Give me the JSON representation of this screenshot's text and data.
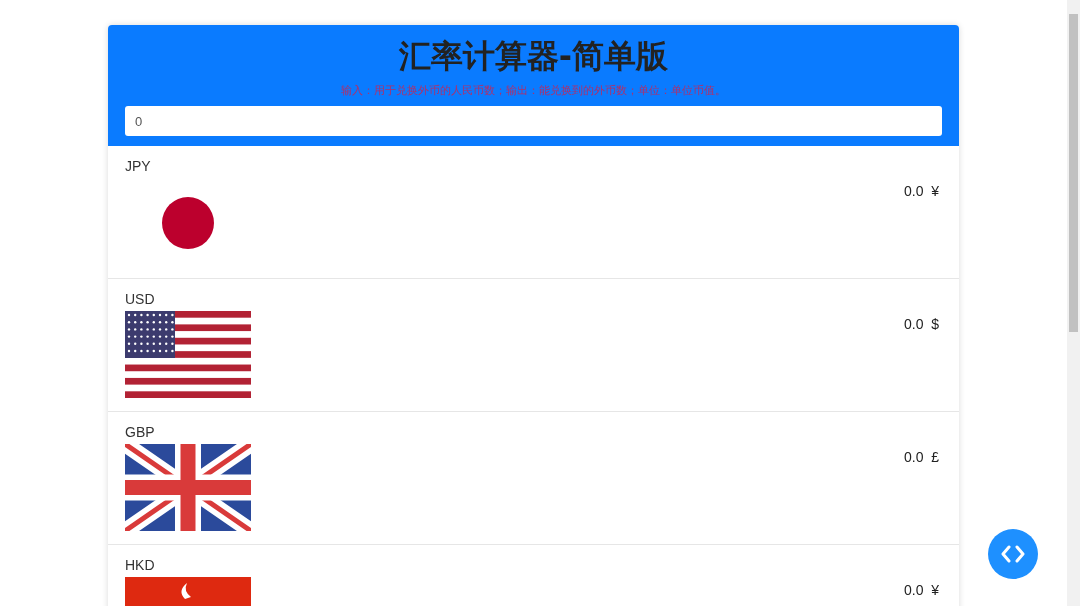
{
  "header": {
    "title": "汇率计算器-简单版",
    "subtitle": "输入：用于兑换外币的人民币数；输出：能兑换到的外币数；单位：单位币值。",
    "input": {
      "value": "0"
    }
  },
  "currencies": [
    {
      "code": "JPY",
      "kind": "jp",
      "amount": "0.0",
      "symbol": "¥"
    },
    {
      "code": "USD",
      "kind": "us",
      "amount": "0.0",
      "symbol": "$"
    },
    {
      "code": "GBP",
      "kind": "gb",
      "amount": "0.0",
      "symbol": "£"
    },
    {
      "code": "HKD",
      "kind": "hk",
      "amount": "0.0",
      "symbol": "¥"
    }
  ]
}
